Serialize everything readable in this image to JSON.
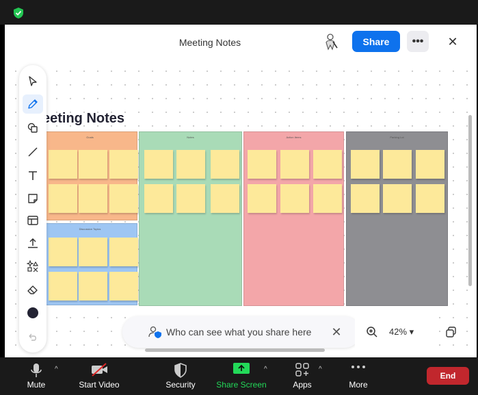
{
  "window": {
    "title": "Meeting Notes"
  },
  "header": {
    "share_label": "Share",
    "more_label": "•••",
    "close_label": "✕"
  },
  "toolbar": {
    "tools": [
      "select",
      "pen",
      "shapes",
      "line",
      "text",
      "sticky-note",
      "template",
      "upload",
      "generate",
      "eraser",
      "color",
      "undo"
    ],
    "active": "pen",
    "color": "#232333"
  },
  "board": {
    "title": "eeting Notes",
    "columns": [
      {
        "label": "Goals",
        "color": "#f8b78a",
        "notes": 6
      },
      {
        "label": "Discussion Topics",
        "color": "#9ec6f3",
        "notes": 6
      },
      {
        "label": "Notes",
        "color": "#a9dbb7",
        "notes": 6
      },
      {
        "label": "Action Items",
        "color": "#f3a6a9",
        "notes": 6
      },
      {
        "label": "Parking Lot",
        "color": "#8e8e92",
        "notes": 6
      }
    ]
  },
  "privacy": {
    "text": "Who can see what you share here",
    "close_label": "✕"
  },
  "zoom": {
    "level": "42%",
    "caret": "▾"
  },
  "bottombar": {
    "mute": "Mute",
    "start_video": "Start Video",
    "security": "Security",
    "share_screen": "Share Screen",
    "apps": "Apps",
    "more": "More",
    "end": "End",
    "accent_green": "#23d959",
    "end_color": "#c1272d"
  }
}
